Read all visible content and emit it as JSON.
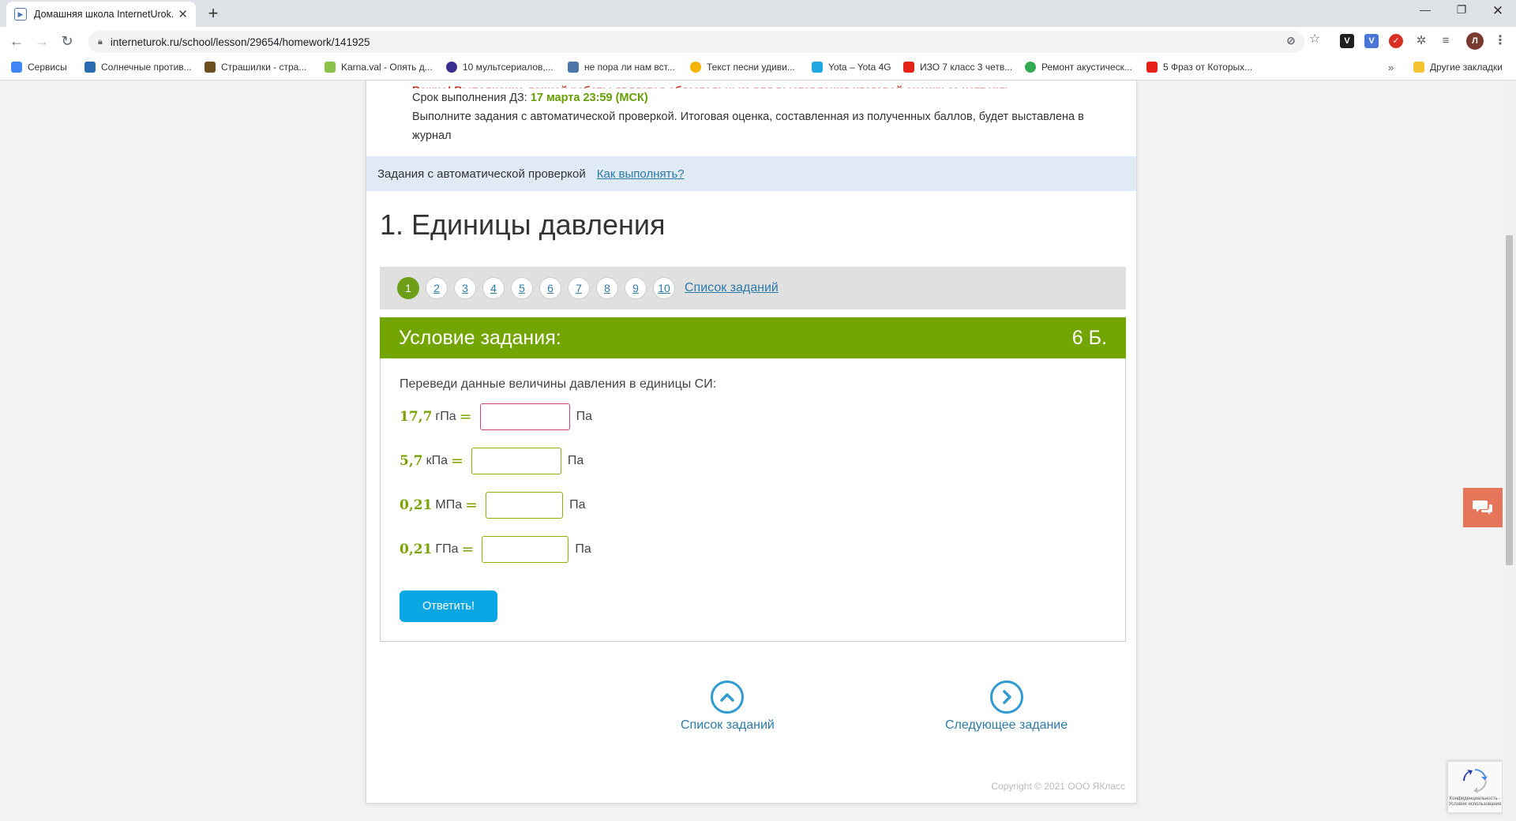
{
  "browser": {
    "tab_title": "Домашняя школа InternetUrok.ru",
    "url": "interneturok.ru/school/lesson/29654/homework/141925",
    "bookmarks": [
      {
        "label": "Сервисы",
        "color": "#4285f4"
      },
      {
        "label": "Солнечные против...",
        "color": "#2b6cb0"
      },
      {
        "label": "Страшилки - стра...",
        "color": "#6b4f1d"
      },
      {
        "label": "Karna.val - Опять д...",
        "color": "#8bc34a"
      },
      {
        "label": "10 мультсериалов,...",
        "color": "#3b2d8f"
      },
      {
        "label": "не пора ли нам вст...",
        "color": "#4a76a8"
      },
      {
        "label": "Текст песни удиви...",
        "color": "#f4b400"
      },
      {
        "label": "Yota – Yota 4G",
        "color": "#1ea7e0"
      },
      {
        "label": "ИЗО 7 класс 3 четв...",
        "color": "#e62117"
      },
      {
        "label": "Ремонт акустическ...",
        "color": "#34a853"
      },
      {
        "label": "5 Фраз от Которых...",
        "color": "#e62117"
      }
    ],
    "other_bookmarks": "Другие закладки"
  },
  "info": {
    "red_line": "Важно! Выполнение данной работы является обязательным для выставления итоговой оценки за четверть.",
    "deadline_label": "Срок выполнения ДЗ: ",
    "deadline_date": "17 марта 23:59 (МСК)",
    "description": "Выполните задания с автоматической проверкой. Итоговая оценка, составленная из полученных баллов, будет выставлена в журнал"
  },
  "auto_strip": {
    "label": "Задания с автоматической проверкой",
    "how_link": "Как выполнять?"
  },
  "task": {
    "title": "1. Единицы давления",
    "pages": [
      "1",
      "2",
      "3",
      "4",
      "5",
      "6",
      "7",
      "8",
      "9",
      "10"
    ],
    "active_page": "1",
    "list_link": "Список заданий",
    "condition_label": "Условие задания:",
    "points": "6 Б.",
    "prompt": "Переведи данные величины давления в единицы СИ:",
    "rows": [
      {
        "value": "17,7",
        "unit": "гПа",
        "eq": "=",
        "answer": "",
        "result_unit": "Па"
      },
      {
        "value": "5,7",
        "unit": "кПа",
        "eq": "=",
        "answer": "",
        "result_unit": "Па"
      },
      {
        "value": "0,21",
        "unit": "МПа",
        "eq": "=",
        "answer": "",
        "result_unit": "Па"
      },
      {
        "value": "0,21",
        "unit": "ГПа",
        "eq": "=",
        "answer": "",
        "result_unit": "Па"
      }
    ],
    "submit": "Ответить!"
  },
  "footer": {
    "list_label": "Список заданий",
    "next_label": "Следующее задание",
    "copyright": "Copyright © 2021 ООО ЯКласс"
  },
  "recaptcha_text": "Конфиденциальность - Условия использования",
  "colors": {
    "accent_green": "#73a500",
    "link_blue": "#2c7aa8",
    "button_blue": "#0aa5e3",
    "chat_orange": "#e5765a"
  }
}
